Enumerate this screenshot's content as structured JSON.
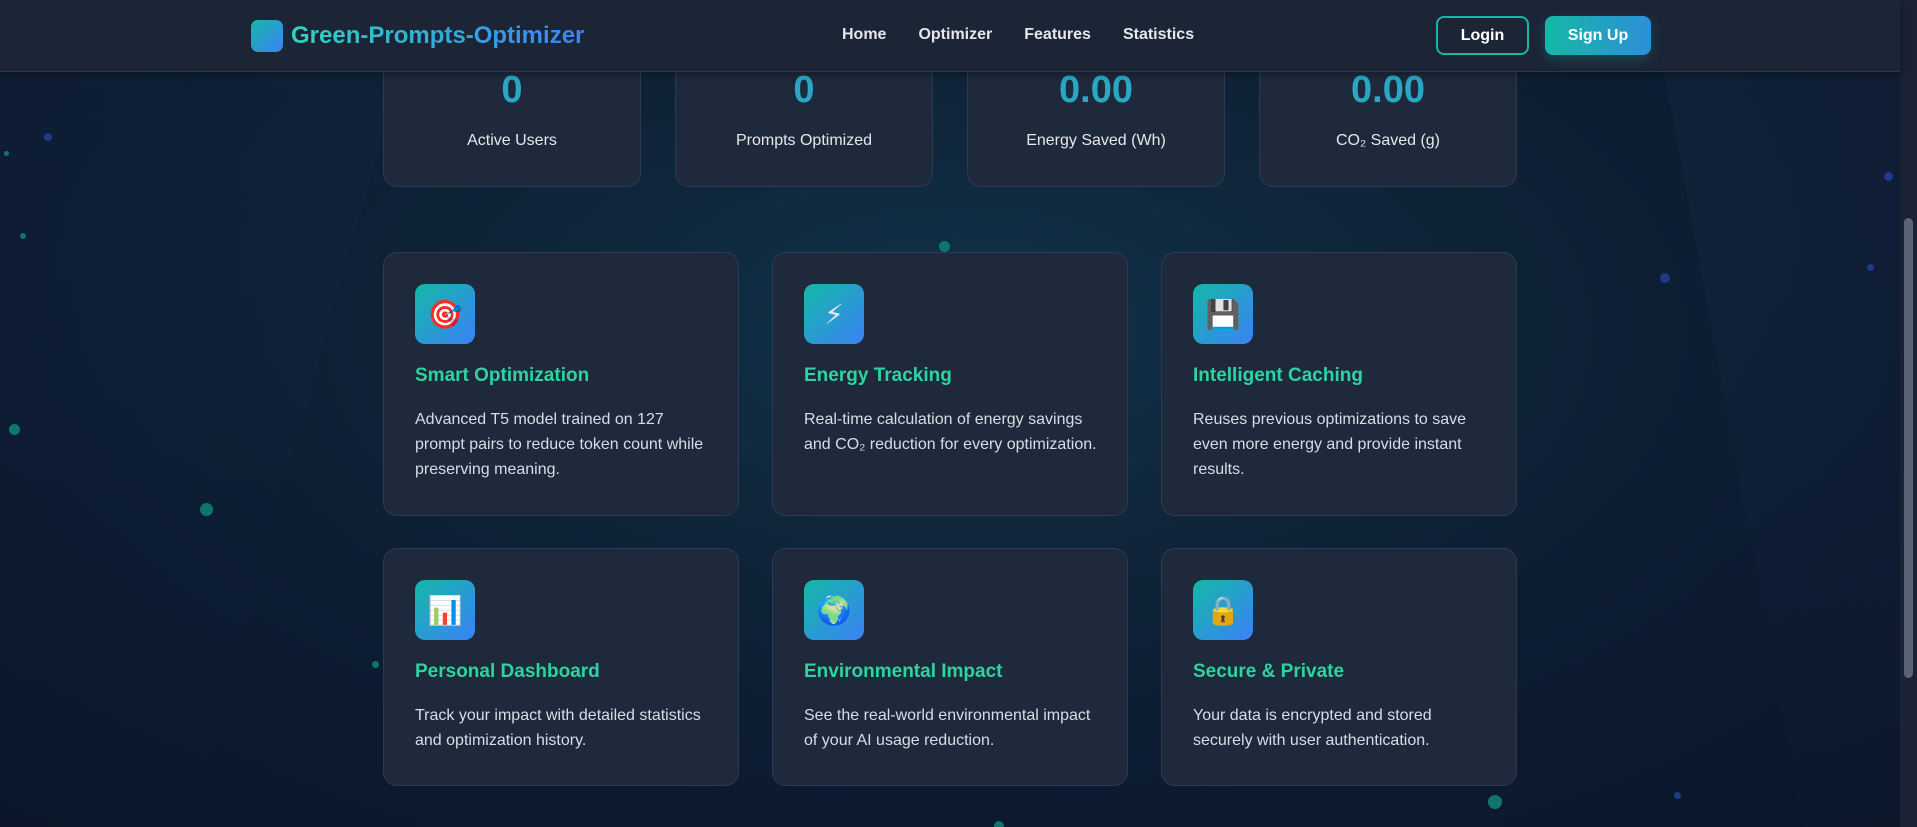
{
  "navbar": {
    "brand": "Green-Prompts-Optimizer",
    "links": [
      "Home",
      "Optimizer",
      "Features",
      "Statistics"
    ],
    "login_label": "Login",
    "signup_label": "Sign Up"
  },
  "stats": [
    {
      "value": "0",
      "label": "Active Users"
    },
    {
      "value": "0",
      "label": "Prompts Optimized"
    },
    {
      "value": "0.00",
      "label": "Energy Saved (Wh)"
    },
    {
      "value": "0.00",
      "label": "CO₂ Saved (g)"
    }
  ],
  "features": [
    {
      "icon": "🎯",
      "icon_name": "target-icon",
      "title": "Smart Optimization",
      "description": "Advanced T5 model trained on 127 prompt pairs to reduce token count while preserving meaning."
    },
    {
      "icon": "⚡",
      "icon_name": "lightning-icon",
      "title": "Energy Tracking",
      "description": "Real-time calculation of energy savings and CO₂ reduction for every optimization."
    },
    {
      "icon": "💾",
      "icon_name": "floppy-disk-icon",
      "title": "Intelligent Caching",
      "description": "Reuses previous optimizations to save even more energy and provide instant results."
    },
    {
      "icon": "📊",
      "icon_name": "bar-chart-icon",
      "title": "Personal Dashboard",
      "description": "Track your impact with detailed statistics and optimization history."
    },
    {
      "icon": "🌍",
      "icon_name": "globe-icon",
      "title": "Environmental Impact",
      "description": "See the real-world environmental impact of your AI usage reduction."
    },
    {
      "icon": "🔒",
      "icon_name": "lock-icon",
      "title": "Secure & Private",
      "description": "Your data is encrypted and stored securely with user authentication."
    }
  ],
  "colors": {
    "accent_teal": "#14b8a6",
    "accent_blue": "#3b82f6",
    "stat_value": "#2aa7c4",
    "feature_title": "#2dd4a0",
    "card_bg": "#1e293b",
    "page_bg": "#0f2438"
  }
}
